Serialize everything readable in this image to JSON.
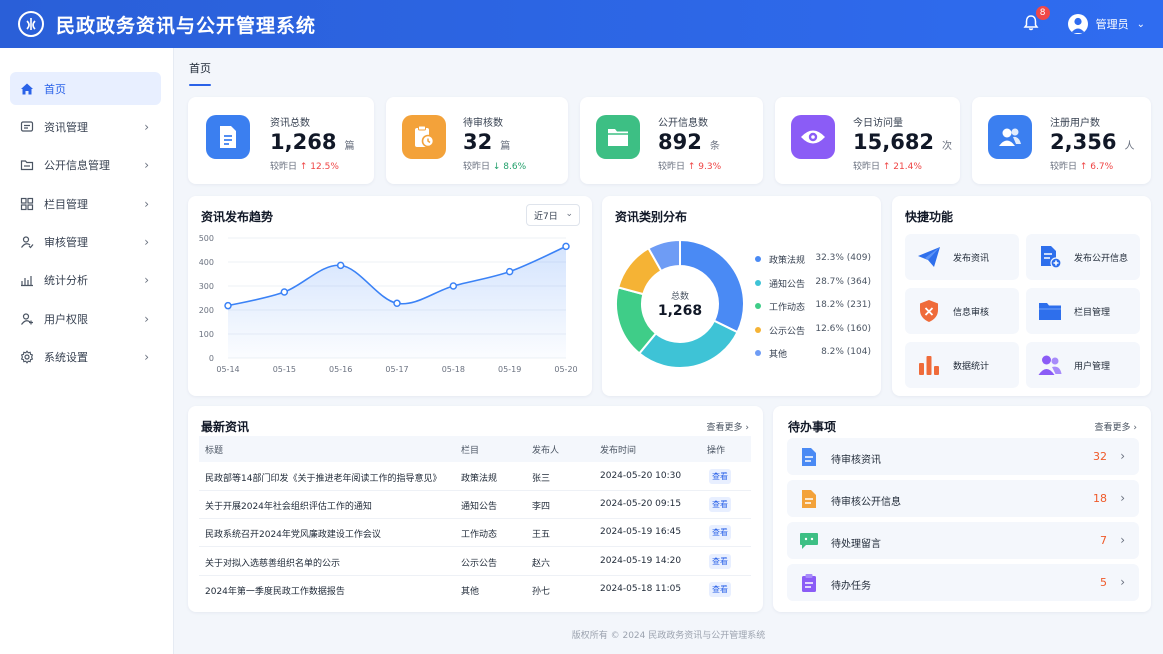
{
  "header": {
    "title": "民政政务资讯与公开管理系统",
    "notification_count": "8",
    "user_name": "管理员"
  },
  "sidebar": {
    "items": [
      {
        "label": "首页",
        "icon": "home-icon",
        "active": true
      },
      {
        "label": "资讯管理",
        "icon": "message-icon"
      },
      {
        "label": "公开信息管理",
        "icon": "folder-icon"
      },
      {
        "label": "栏目管理",
        "icon": "grid-icon"
      },
      {
        "label": "审核管理",
        "icon": "user-check-icon"
      },
      {
        "label": "统计分析",
        "icon": "bar-chart-icon"
      },
      {
        "label": "用户权限",
        "icon": "user-plus-icon"
      },
      {
        "label": "系统设置",
        "icon": "gear-icon"
      }
    ]
  },
  "breadcrumb": "首页",
  "stats": [
    {
      "label": "资讯总数",
      "value": "1,268",
      "unit": "篇",
      "compare_label": "较昨日",
      "change": "12.5%",
      "trend": "up",
      "color": "#3b7ff0",
      "icon": "document-icon"
    },
    {
      "label": "待审核数",
      "value": "32",
      "unit": "篇",
      "compare_label": "较昨日",
      "change": "8.6%",
      "trend": "down",
      "color": "#f3a23a",
      "icon": "clipboard-clock-icon"
    },
    {
      "label": "公开信息数",
      "value": "892",
      "unit": "条",
      "compare_label": "较昨日",
      "change": "9.3%",
      "trend": "up",
      "color": "#3dbf84",
      "icon": "folder-icon"
    },
    {
      "label": "今日访问量",
      "value": "15,682",
      "unit": "次",
      "compare_label": "较昨日",
      "change": "21.4%",
      "trend": "up",
      "color": "#8b5cf6",
      "icon": "eye-icon"
    },
    {
      "label": "注册用户数",
      "value": "2,356",
      "unit": "人",
      "compare_label": "较昨日",
      "change": "6.7%",
      "trend": "up",
      "color": "#3b7ff0",
      "icon": "users-icon"
    }
  ],
  "trend": {
    "title": "资讯发布趋势",
    "range": "近7日",
    "chart_data": {
      "type": "area",
      "x": [
        "05-14",
        "05-15",
        "05-16",
        "05-17",
        "05-18",
        "05-19",
        "05-20"
      ],
      "values": [
        218,
        275,
        386,
        228,
        300,
        360,
        465
      ],
      "ylim": [
        0,
        500
      ],
      "yticks": [
        "0",
        "100",
        "200",
        "300",
        "400",
        "500"
      ],
      "color": "#3b82f6"
    }
  },
  "category": {
    "title": "资讯类别分布",
    "center_label": "总数",
    "center_value": "1,268",
    "chart_data": {
      "type": "pie",
      "series": [
        {
          "name": "政策法规",
          "pct": "32.3%",
          "count": "(409)",
          "value": 409,
          "color": "#4a8af4"
        },
        {
          "name": "通知公告",
          "pct": "28.7%",
          "count": "(364)",
          "value": 364,
          "color": "#3ec3d6"
        },
        {
          "name": "工作动态",
          "pct": "18.2%",
          "count": "(231)",
          "value": 231,
          "color": "#3fcd88"
        },
        {
          "name": "公示公告",
          "pct": "12.6%",
          "count": "(160)",
          "value": 160,
          "color": "#f5b335"
        },
        {
          "name": "其他",
          "pct": "8.2%",
          "count": "(104)",
          "value": 104,
          "color": "#6e9cf5"
        }
      ]
    }
  },
  "quick": {
    "title": "快捷功能",
    "items": [
      {
        "label": "发布资讯",
        "icon": "send-icon"
      },
      {
        "label": "发布公开信息",
        "icon": "document-add-icon"
      },
      {
        "label": "信息审核",
        "icon": "shield-icon"
      },
      {
        "label": "栏目管理",
        "icon": "folder-icon"
      },
      {
        "label": "数据统计",
        "icon": "bar-chart-icon"
      },
      {
        "label": "用户管理",
        "icon": "users-icon"
      }
    ]
  },
  "news": {
    "title": "最新资讯",
    "more": "查看更多",
    "columns": [
      "标题",
      "栏目",
      "发布人",
      "发布时间",
      "操作"
    ],
    "view_label": "查看",
    "rows": [
      {
        "title": "民政部等14部门印发《关于推进老年阅读工作的指导意见》",
        "category": "政策法规",
        "author": "张三",
        "time": "2024-05-20 10:30"
      },
      {
        "title": "关于开展2024年社会组织评估工作的通知",
        "category": "通知公告",
        "author": "李四",
        "time": "2024-05-20 09:15"
      },
      {
        "title": "民政系统召开2024年党风廉政建设工作会议",
        "category": "工作动态",
        "author": "王五",
        "time": "2024-05-19 16:45"
      },
      {
        "title": "关于对拟入选慈善组织名单的公示",
        "category": "公示公告",
        "author": "赵六",
        "time": "2024-05-19 14:20"
      },
      {
        "title": "2024年第一季度民政工作数据报告",
        "category": "其他",
        "author": "孙七",
        "time": "2024-05-18 11:05"
      }
    ]
  },
  "todo": {
    "title": "待办事项",
    "more": "查看更多",
    "items": [
      {
        "label": "待审核资讯",
        "count": "32",
        "icon": "document-icon",
        "color": "#4a8af4"
      },
      {
        "label": "待审核公开信息",
        "count": "18",
        "icon": "document-icon",
        "color": "#f3a23a"
      },
      {
        "label": "待处理留言",
        "count": "7",
        "icon": "chat-icon",
        "color": "#3dbf84"
      },
      {
        "label": "待办任务",
        "count": "5",
        "icon": "clipboard-icon",
        "color": "#8b5cf6"
      }
    ]
  },
  "footer": "版权所有 © 2024 民政政务资讯与公开管理系统"
}
